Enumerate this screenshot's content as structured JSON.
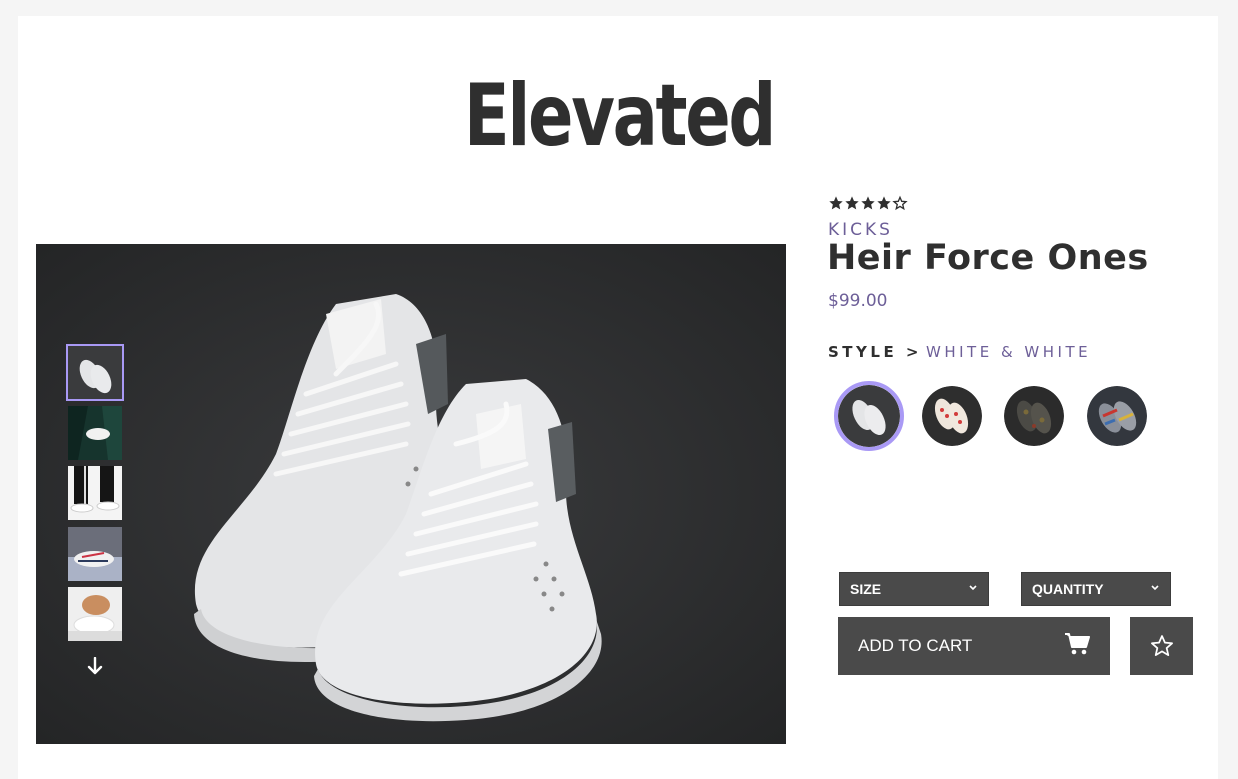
{
  "header": {
    "brand": "Elevated"
  },
  "product": {
    "rating": 4,
    "rating_max": 5,
    "category": "KICKS",
    "name": "Heir Force Ones",
    "price": "$99.00",
    "style_label": "STYLE >",
    "style_value": "WHITE & WHITE"
  },
  "gallery": {
    "thumbnails": [
      "white-sneakers-dark",
      "sneaker-green-jacket",
      "sneakers-black-pants",
      "runner-sneakers",
      "sneaker-hand"
    ],
    "active_thumbnail": 0,
    "down_icon": "arrow-down-icon"
  },
  "styles": {
    "swatches": [
      "white-white",
      "red-pattern",
      "black-camo",
      "multi-color"
    ],
    "active_swatch": 0
  },
  "controls": {
    "size_label": "SIZE",
    "quantity_label": "QUANTITY",
    "add_to_cart_label": "ADD TO CART",
    "cart_icon": "cart-icon",
    "favorite_icon": "star-outline-icon"
  },
  "colors": {
    "accent": "#a999f5",
    "muted_purple": "#6d5f98",
    "button_bg": "#4a4a4a",
    "text_dark": "#2f2f2f"
  }
}
